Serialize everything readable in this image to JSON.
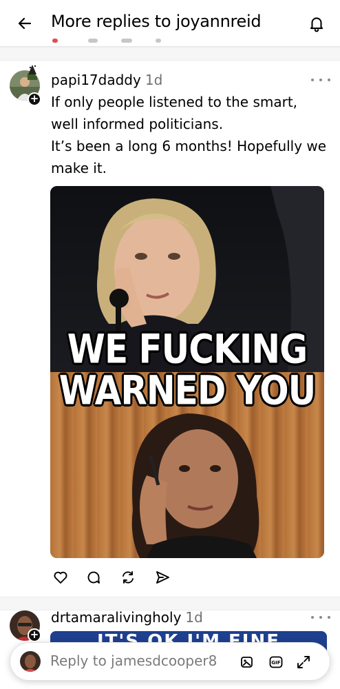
{
  "header": {
    "back_icon": "arrow-left-icon",
    "title": "More replies to joyannreid",
    "bell_icon": "bell-icon"
  },
  "posts": [
    {
      "username": "papi17daddy",
      "time": "1d",
      "lines": [
        "If only people listened to the smart,",
        "well informed politicians.",
        "It’s been a long 6 months! Hopefully we",
        "make it."
      ],
      "image": {
        "caption_line1": "WE FUCKING",
        "caption_line2": "WARNED YOU"
      },
      "actions": [
        "heart-icon",
        "comment-icon",
        "repost-icon",
        "share-icon"
      ]
    },
    {
      "username": "drtamaralivingholy",
      "time": "1d",
      "preview_text": "IT'S OK   I'M FINE"
    }
  ],
  "reply_bar": {
    "placeholder": "Reply to jamesdcooper8",
    "icons": [
      "image-icon",
      "gif-icon",
      "expand-icon"
    ]
  },
  "colors": {
    "accent": "#000000",
    "muted": "#707070",
    "preview_blue": "#1f3f8f"
  }
}
